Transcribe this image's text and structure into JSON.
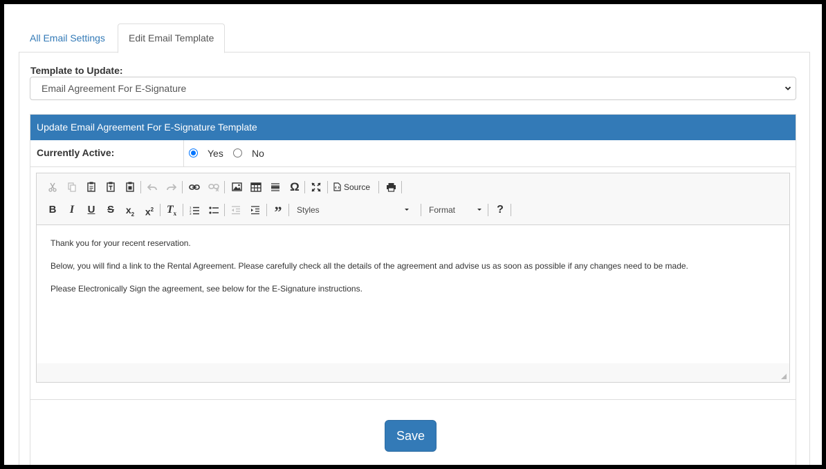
{
  "tabs": [
    {
      "label": "All Email Settings"
    },
    {
      "label": "Edit Email Template"
    }
  ],
  "template": {
    "label": "Template to Update:",
    "selected": "Email Agreement For E-Signature"
  },
  "panel": {
    "heading": "Update Email Agreement For E-Signature Template",
    "active_label": "Currently Active:",
    "yes_label": "Yes",
    "no_label": "No"
  },
  "editor": {
    "source_label": "Source",
    "styles_label": "Styles",
    "format_label": "Format",
    "paragraphs": [
      "Thank you for your recent reservation.",
      "Below, you will find a link to the Rental Agreement. Please carefully check all the details of the agreement and advise us as soon as possible if any changes need to be made.",
      "Please Electronically Sign the agreement, see below for the E-Signature instructions."
    ]
  },
  "save_label": "Save",
  "colors": {
    "primary": "#337ab7",
    "link": "#337ab7"
  }
}
